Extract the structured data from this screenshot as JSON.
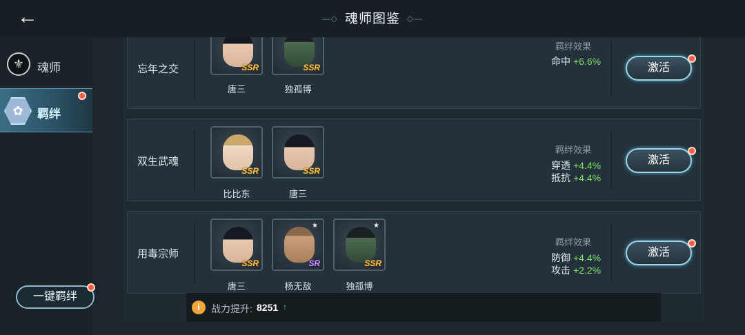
{
  "header": {
    "title": "魂师图鉴",
    "back_icon": "arrow-left-icon"
  },
  "sidebar": {
    "items": [
      {
        "label": "魂师",
        "icon": "soul-master-emblem-icon",
        "active": false
      },
      {
        "label": "羁绊",
        "icon": "bond-flower-icon",
        "active": true
      }
    ],
    "one_key_label": "一键羁绊"
  },
  "bonds": [
    {
      "name": "忘年之交",
      "heroes": [
        {
          "name": "唐三",
          "rarity": "SSR",
          "starred": false
        },
        {
          "name": "独孤博",
          "rarity": "SSR",
          "starred": true
        }
      ],
      "effect_title": "羁绊效果",
      "effects": [
        {
          "stat": "命中",
          "value": "+6.6%"
        }
      ],
      "button_label": "激活"
    },
    {
      "name": "双生武魂",
      "heroes": [
        {
          "name": "比比东",
          "rarity": "SSR",
          "starred": false
        },
        {
          "name": "唐三",
          "rarity": "SSR",
          "starred": false
        }
      ],
      "effect_title": "羁绊效果",
      "effects": [
        {
          "stat": "穿透",
          "value": "+4.4%"
        },
        {
          "stat": "抵抗",
          "value": "+4.4%"
        }
      ],
      "button_label": "激活"
    },
    {
      "name": "用毒宗师",
      "heroes": [
        {
          "name": "唐三",
          "rarity": "SSR",
          "starred": false
        },
        {
          "name": "杨无敌",
          "rarity": "SR",
          "starred": true
        },
        {
          "name": "独孤博",
          "rarity": "SSR",
          "starred": true
        }
      ],
      "effect_title": "羁绊效果",
      "effects": [
        {
          "stat": "防御",
          "value": "+4.4%"
        },
        {
          "stat": "攻击",
          "value": "+2.2%"
        }
      ],
      "button_label": "激活"
    }
  ],
  "power": {
    "label": "战力提升:",
    "value": "8251",
    "icon": "info-icon",
    "trend_icon": "up-arrow-icon"
  },
  "colors": {
    "accent": "#9fd6ea",
    "positive": "#7de26a",
    "badge": "#ff5a4a",
    "ssr": "#f6c54a",
    "sr": "#c99bff"
  }
}
